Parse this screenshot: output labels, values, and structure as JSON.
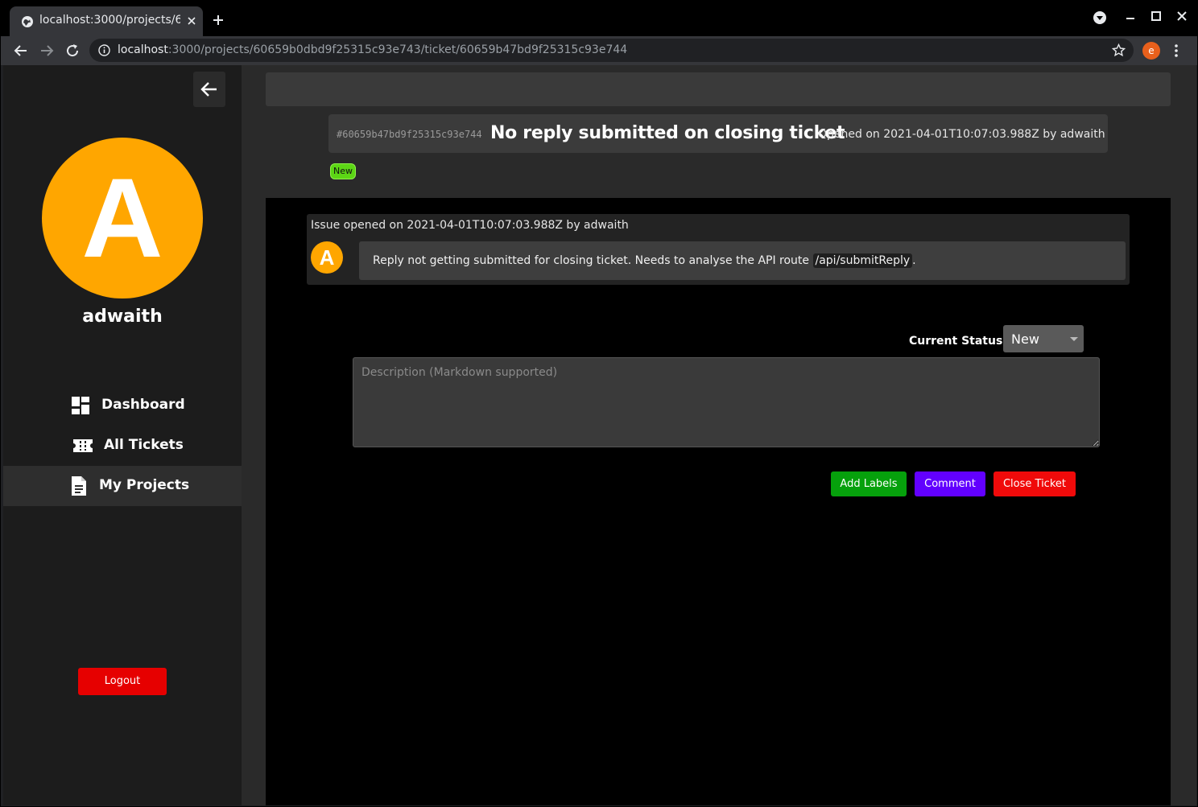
{
  "browser": {
    "tab_title": "localhost:3000/projects/6",
    "url_host": "localhost",
    "url_rest": ":3000/projects/60659b0dbd9f25315c93e743/ticket/60659b47bd9f25315c93e744",
    "profile_initial": "e",
    "profile_color": "#e8601c"
  },
  "sidebar": {
    "avatar_initial": "A",
    "avatar_color": "#ffa600",
    "username": "adwaith",
    "nav": [
      {
        "label": "Dashboard",
        "icon": "dashboard-icon"
      },
      {
        "label": "All Tickets",
        "icon": "ticket-icon"
      },
      {
        "label": "My Projects",
        "icon": "document-icon",
        "active": true
      }
    ],
    "logout_label": "Logout"
  },
  "ticket": {
    "id": "#60659b47bd9f25315c93e744",
    "title": "No reply submitted on closing ticket",
    "opened_text": "Opened on 2021-04-01T10:07:03.988Z by adwaith",
    "status_pill": "New",
    "status_pill_color": "#5cd615"
  },
  "comment": {
    "meta": "Issue opened on 2021-04-01T10:07:03.988Z by adwaith",
    "avatar_initial": "A",
    "text_before": "Reply not getting submitted for closing ticket. Needs to analyse the API route ",
    "code": "/api/submitReply",
    "text_after": "."
  },
  "form": {
    "status_label": "Current Status",
    "status_value": "New",
    "description_placeholder": "Description (Markdown supported)",
    "buttons": {
      "add_labels": "Add Labels",
      "comment": "Comment",
      "close_ticket": "Close Ticket"
    },
    "colors": {
      "add_labels": "#06a10c",
      "comment": "#6200ff",
      "close_ticket": "#f00a0a"
    }
  }
}
